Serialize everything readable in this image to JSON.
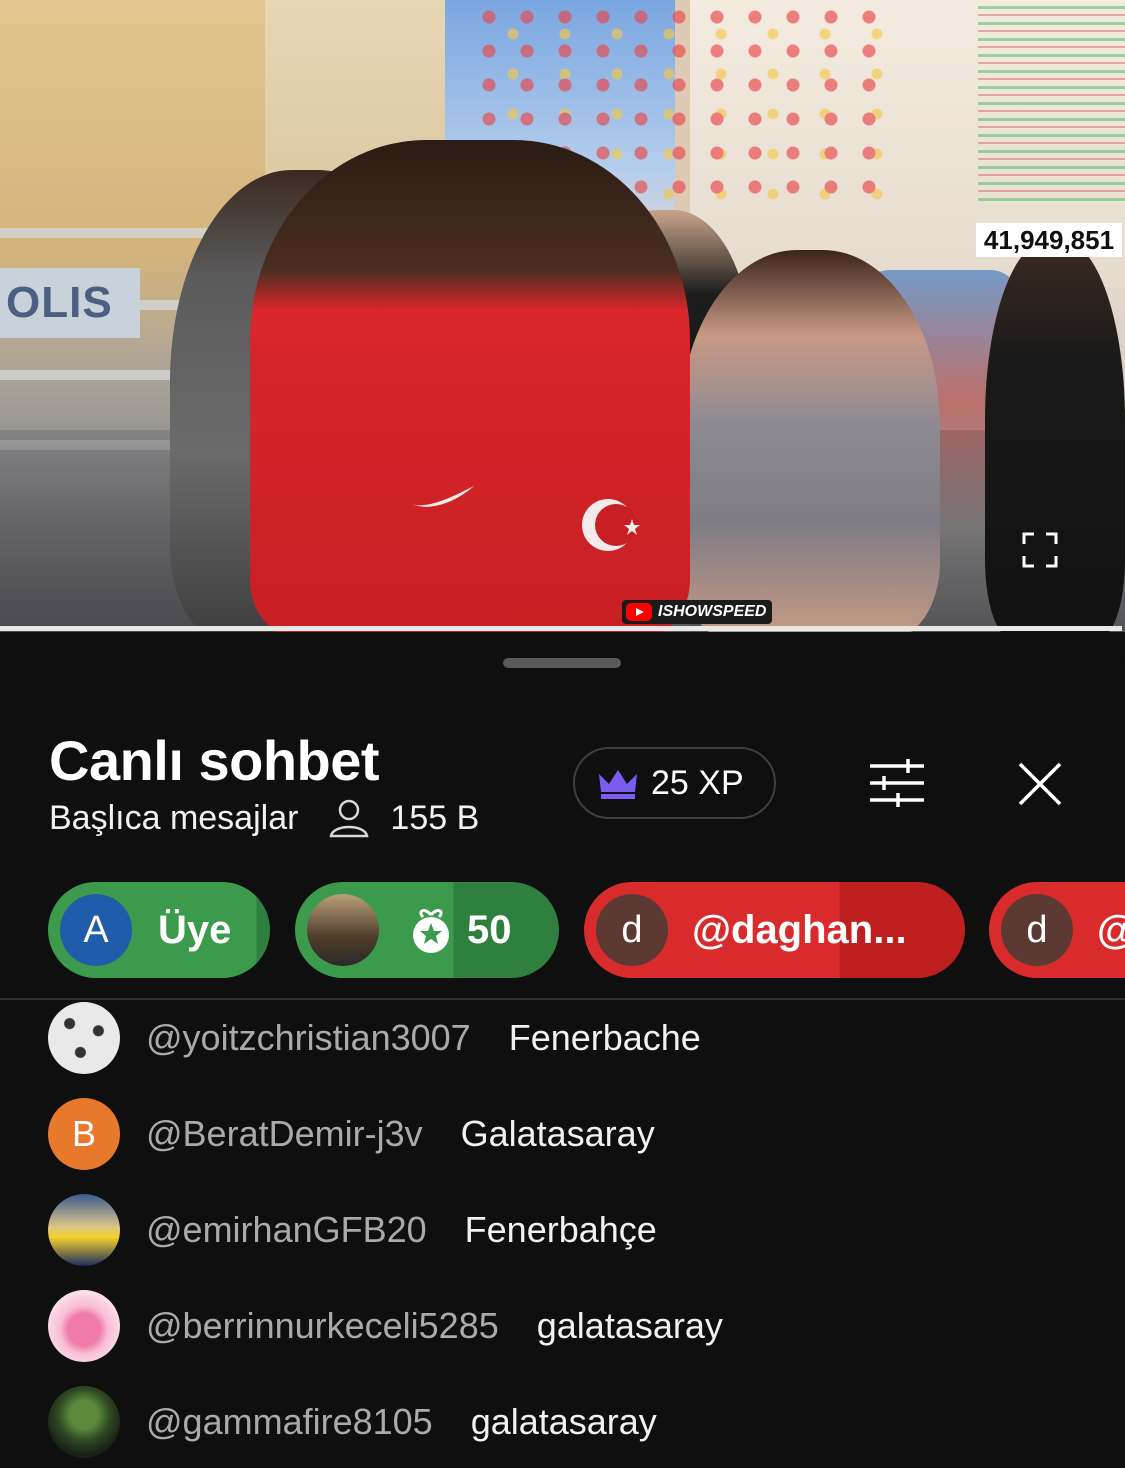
{
  "video": {
    "view_count": "41,949,851",
    "watermark": "ISHOWSPEED",
    "sign_text": "OLIS"
  },
  "chat": {
    "title": "Canlı sohbet",
    "mode": "Başlıca mesajlar",
    "viewer_count": "155 B",
    "xp": "25 XP",
    "icons": {
      "viewers": "person-icon",
      "xp": "crown-icon",
      "tune": "tune-icon",
      "close": "close-icon"
    },
    "chips": [
      {
        "avatar_letter": "A",
        "label": "Üye",
        "color": "#3c9a4d"
      },
      {
        "avatar_letter": "",
        "label": "50",
        "color": "#3c9a4d"
      },
      {
        "avatar_letter": "d",
        "label": "@daghan...",
        "color": "#d92b2b"
      },
      {
        "avatar_letter": "d",
        "label": "@",
        "color": "#d92b2b"
      }
    ],
    "messages": [
      {
        "avatar_letter": "",
        "author": "@yoitzchristian3007",
        "text": "Fenerbache"
      },
      {
        "avatar_letter": "B",
        "author": "@BeratDemir-j3v",
        "text": "Galatasaray"
      },
      {
        "avatar_letter": "",
        "author": "@emirhanGFB20",
        "text": "Fenerbahçe"
      },
      {
        "avatar_letter": "",
        "author": "@berrinnurkeceli5285",
        "text": "galatasaray"
      },
      {
        "avatar_letter": "",
        "author": "@gammafire8105",
        "text": "galatasaray"
      }
    ]
  },
  "colors": {
    "background": "#0f0f0f",
    "chip_green": "#3c9a4d",
    "chip_red": "#d92b2b",
    "crown_purple": "#7b5cf0"
  }
}
